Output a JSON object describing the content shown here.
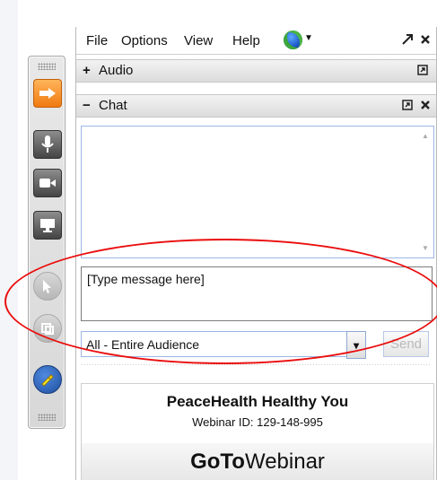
{
  "menu": {
    "file": "File",
    "options": "Options",
    "view": "View",
    "help": "Help"
  },
  "icons": {
    "globe": "globe-icon",
    "expand": "expand-icon",
    "close": "close-icon",
    "restore": "restore-icon",
    "audio_plus": "plus-icon",
    "chat_minus": "minus-icon"
  },
  "sections": {
    "audio": "Audio",
    "chat": "Chat"
  },
  "chat": {
    "placeholder": "[Type message here]",
    "audience": "All - Entire Audience",
    "send": "Send"
  },
  "footer": {
    "organization": "PeaceHealth Healthy You",
    "webinar_id": "Webinar ID: 129-148-995",
    "brand_bold": "GoTo",
    "brand_regular": "Webinar"
  },
  "colors": {
    "accent_orange": "#f07a10",
    "highlight_red": "#ea0d0d",
    "border_blue": "#9bb7e5"
  }
}
